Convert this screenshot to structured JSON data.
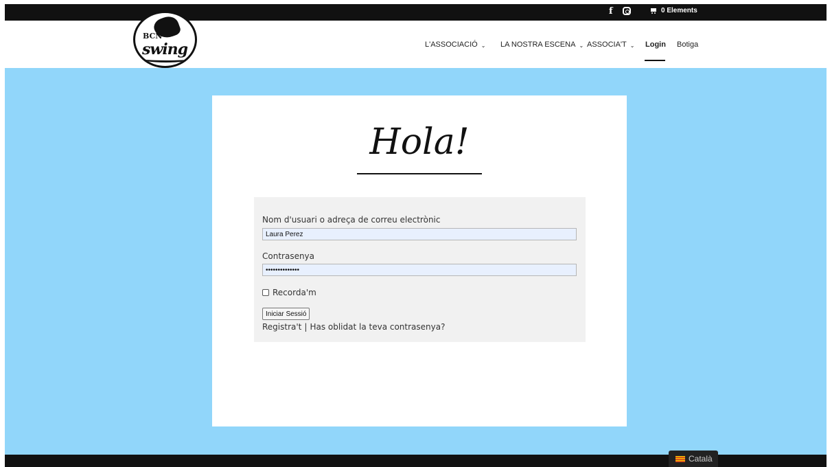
{
  "topbar": {
    "facebook_glyph": "f",
    "cart_label": "0 Elements",
    "icons": [
      "facebook-icon",
      "instagram-icon",
      "cart-icon"
    ]
  },
  "logo": {
    "line1": "BCN",
    "line2": "swing"
  },
  "nav": {
    "items": [
      {
        "label": "L'ASSOCIACIÓ",
        "has_dropdown": true
      },
      {
        "label": "LA NOSTRA ESCENA",
        "has_dropdown": true
      },
      {
        "label": "ASSOCIA'T",
        "has_dropdown": true
      },
      {
        "label": "Login",
        "has_dropdown": false,
        "active": true
      },
      {
        "label": "Botiga",
        "has_dropdown": false
      }
    ],
    "chevron": "⌄"
  },
  "page": {
    "heading": "Hola!",
    "background_color": "#91d6fa"
  },
  "form": {
    "username_label": "Nom d'usuari o adreça de correu electrònic",
    "username_value": "Laura Perez",
    "password_label": "Contrasenya",
    "password_value": "••••••••••••••",
    "remember_label": "Recorda'm",
    "submit_label": "Iniciar Sessió",
    "register_link": "Registra't",
    "separator": "|",
    "forgot_link": "Has oblidat la teva contrasenya?"
  },
  "footer": {
    "language_label": "Català"
  }
}
